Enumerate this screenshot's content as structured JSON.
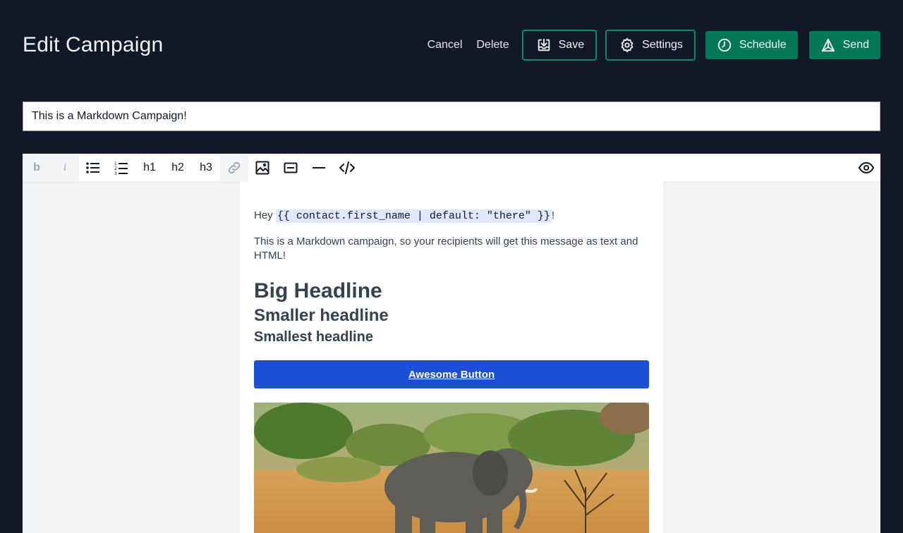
{
  "header": {
    "title": "Edit Campaign",
    "cancel_label": "Cancel",
    "delete_label": "Delete",
    "save_label": "Save",
    "settings_label": "Settings",
    "schedule_label": "Schedule",
    "send_label": "Send"
  },
  "subject": {
    "value": "This is a Markdown Campaign!"
  },
  "toolbar": {
    "items": [
      {
        "label": "b",
        "icon": "bold-icon"
      },
      {
        "label": "i",
        "icon": "italic-icon"
      },
      {
        "icon": "bullet-list-icon"
      },
      {
        "icon": "numbered-list-icon"
      },
      {
        "label": "h1"
      },
      {
        "label": "h2"
      },
      {
        "label": "h3"
      },
      {
        "icon": "link-icon"
      },
      {
        "icon": "image-icon"
      },
      {
        "icon": "button-icon"
      },
      {
        "icon": "horizontal-rule-icon"
      },
      {
        "icon": "code-icon"
      },
      {
        "icon": "preview-eye-icon"
      }
    ]
  },
  "content": {
    "greeting_prefix": "Hey ",
    "greeting_code": "{{ contact.first_name | default: \"there\" }}",
    "greeting_suffix": "!",
    "paragraph": "This is a Markdown campaign, so your recipients will get this message as text and HTML!",
    "h1": "Big Headline",
    "h2": "Smaller headline",
    "h3": "Smallest headline",
    "button_label": "Awesome Button",
    "image_alt": "elephant photo"
  },
  "colors": {
    "background": "#111827",
    "accent": "#047857",
    "button": "#1d4ed8"
  }
}
